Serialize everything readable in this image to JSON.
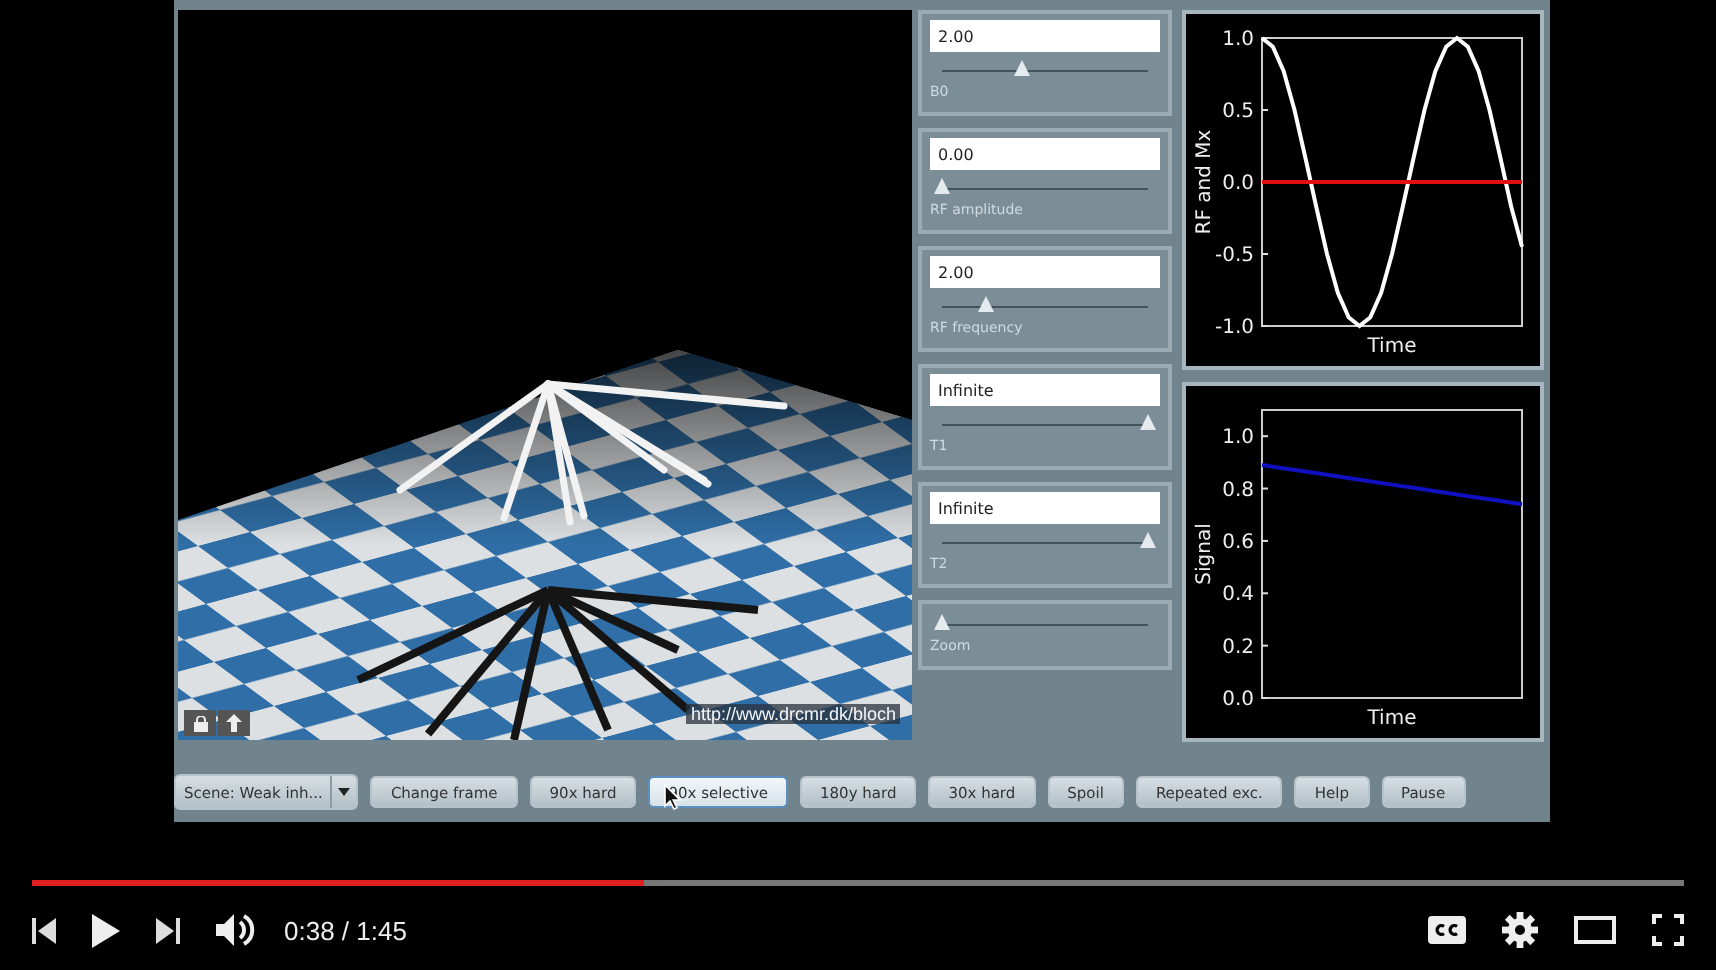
{
  "scene": {
    "url": "http://www.drcmr.dk/bloch"
  },
  "controls": [
    {
      "kind": "field-slider",
      "value": "2.00",
      "level": 0.39,
      "label": "B0"
    },
    {
      "kind": "field-slider",
      "value": "0.00",
      "level": 0.0,
      "label": "RF amplitude"
    },
    {
      "kind": "field-slider",
      "value": "2.00",
      "level": 0.21,
      "label": "RF frequency"
    },
    {
      "kind": "field-slider",
      "value": "Infinite",
      "level": 1.0,
      "label": "T1"
    },
    {
      "kind": "field-slider",
      "value": "Infinite",
      "level": 1.0,
      "label": "T2"
    },
    {
      "kind": "slider",
      "level": 0.0,
      "label": "Zoom"
    }
  ],
  "charts": [
    {
      "chart_data": {
        "type": "line",
        "xlabel": "Time",
        "ylabel": "RF and Mx",
        "categories": [
          null,
          null,
          null,
          null,
          null,
          null,
          null,
          null,
          null,
          null,
          null,
          null,
          null,
          null,
          null,
          null,
          null,
          null,
          null,
          null,
          null,
          null,
          null,
          null,
          null
        ],
        "ylim": [
          -1,
          1
        ],
        "yticks": [
          {
            "value": 1,
            "label": "1.0"
          },
          {
            "value": 0.5,
            "label": "0.5"
          },
          {
            "value": 0,
            "label": "0.0"
          },
          {
            "value": -0.5,
            "label": "-0.5"
          },
          {
            "value": -1,
            "label": "-1.0"
          }
        ],
        "series": [
          {
            "color": "#ffffff",
            "values": [
              1,
              0.94,
              0.77,
              0.5,
              0.17,
              -0.17,
              -0.5,
              -0.77,
              -0.94,
              -1,
              -0.94,
              -0.77,
              -0.5,
              -0.17,
              0.17,
              0.5,
              0.77,
              0.94,
              1,
              0.94,
              0.77,
              0.5,
              0.17,
              -0.17,
              -0.45
            ]
          },
          {
            "color": "#e01010",
            "values": [
              0,
              0,
              0,
              0,
              0,
              0,
              0,
              0,
              0,
              0,
              0,
              0,
              0,
              0,
              0,
              0,
              0,
              0,
              0,
              0,
              0,
              0,
              0,
              0,
              0
            ]
          }
        ]
      }
    },
    {
      "chart_data": {
        "type": "line",
        "xlabel": "Time",
        "ylabel": "Signal",
        "categories": [
          null,
          null,
          null,
          null,
          null,
          null,
          null,
          null,
          null,
          null,
          null
        ],
        "ylim": [
          0,
          1.1
        ],
        "yticks": [
          {
            "value": 1,
            "label": "1.0"
          },
          {
            "value": 0.8,
            "label": "0.8"
          },
          {
            "value": 0.6,
            "label": "0.6"
          },
          {
            "value": 0.4,
            "label": "0.4"
          },
          {
            "value": 0.2,
            "label": "0.2"
          },
          {
            "value": 0,
            "label": "0.0"
          }
        ],
        "series": [
          {
            "color": "#1010c0",
            "values": [
              0.89,
              0.875,
              0.86,
              0.845,
              0.83,
              0.815,
              0.8,
              0.785,
              0.77,
              0.755,
              0.74
            ]
          }
        ]
      }
    }
  ],
  "scene_select": {
    "value": "Scene: Weak inh..."
  },
  "buttons": [
    {
      "label": "Change frame",
      "hovered": false
    },
    {
      "label": "90x hard",
      "hovered": false
    },
    {
      "label": "90x selective",
      "hovered": true
    },
    {
      "label": "180y hard",
      "hovered": false
    },
    {
      "label": "30x hard",
      "hovered": false
    },
    {
      "label": "Spoil",
      "hovered": false
    },
    {
      "label": "Repeated exc.",
      "hovered": false
    },
    {
      "label": "Help",
      "hovered": false
    },
    {
      "label": "Pause",
      "hovered": false
    }
  ],
  "player": {
    "level": 0.37,
    "time": "0:38 / 1:45"
  }
}
